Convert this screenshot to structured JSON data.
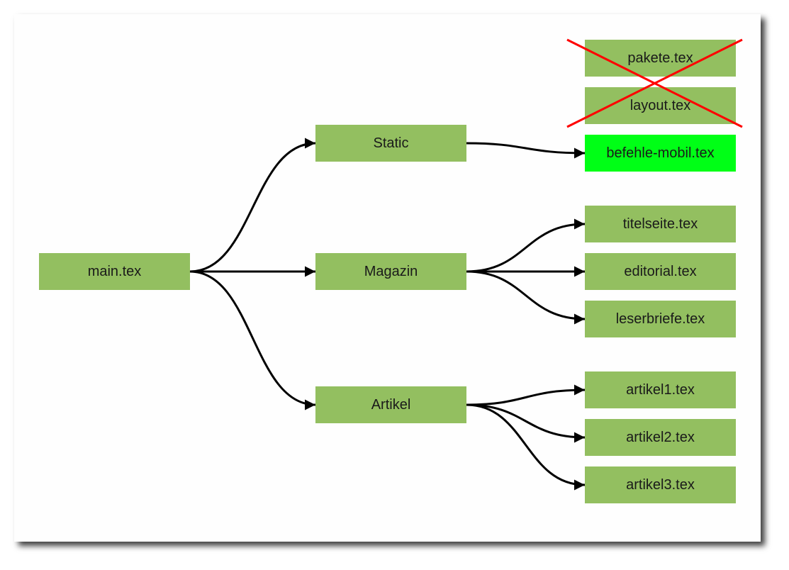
{
  "colors": {
    "node": "#93bf60",
    "highlight": "#00ff16",
    "edge": "#000000",
    "cross": "#ff0000"
  },
  "nodes": {
    "main": {
      "label": "main.tex"
    },
    "static": {
      "label": "Static"
    },
    "magazin": {
      "label": "Magazin"
    },
    "artikel": {
      "label": "Artikel"
    },
    "pakete": {
      "label": "pakete.tex",
      "status": "removed"
    },
    "layout": {
      "label": "layout.tex",
      "status": "removed"
    },
    "befehle": {
      "label": "befehle-mobil.tex",
      "status": "highlighted"
    },
    "titelseite": {
      "label": "titelseite.tex"
    },
    "editorial": {
      "label": "editorial.tex"
    },
    "leserbriefe": {
      "label": "leserbriefe.tex"
    },
    "artikel1": {
      "label": "artikel1.tex"
    },
    "artikel2": {
      "label": "artikel2.tex"
    },
    "artikel3": {
      "label": "artikel3.tex"
    }
  },
  "edges": [
    [
      "main",
      "static"
    ],
    [
      "main",
      "magazin"
    ],
    [
      "main",
      "artikel"
    ],
    [
      "static",
      "befehle"
    ],
    [
      "magazin",
      "titelseite"
    ],
    [
      "magazin",
      "editorial"
    ],
    [
      "magazin",
      "leserbriefe"
    ],
    [
      "artikel",
      "artikel1"
    ],
    [
      "artikel",
      "artikel2"
    ],
    [
      "artikel",
      "artikel3"
    ]
  ]
}
